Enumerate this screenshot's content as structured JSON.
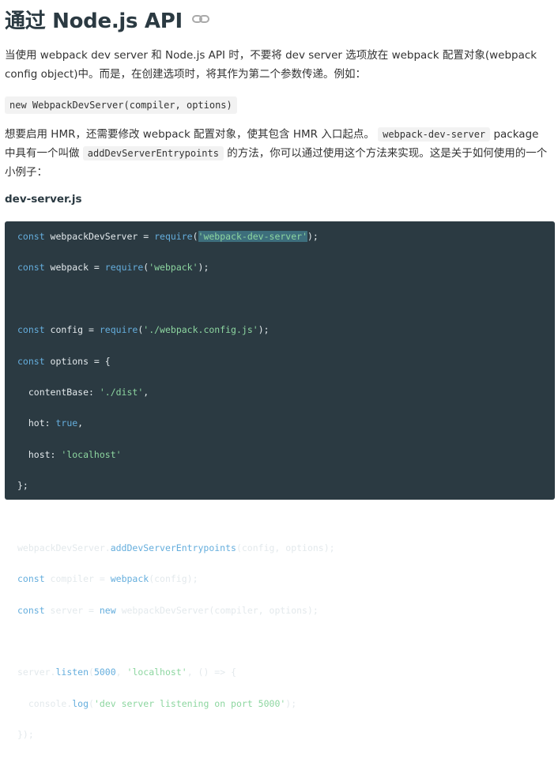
{
  "heading": {
    "title": "通过 Node.js API"
  },
  "intro": {
    "text": "当使用 webpack dev server 和 Node.js API 时，不要将 dev server 选项放在 webpack 配置对象(webpack config object)中。而是，在创建选项时，将其作为第二个参数传递。例如："
  },
  "example_code": "new WebpackDevServer(compiler, options)",
  "hmr": {
    "part1": "想要启用 HMR，还需要修改 webpack 配置对象，使其包含 HMR 入口起点。",
    "code1": "webpack-dev-server",
    "part2": "package 中具有一个叫做",
    "code2": "addDevServerEntrypoints",
    "part3": "的方法，你可以通过使用这个方法来实现。这是关于如何使用的一个小例子："
  },
  "file": {
    "name": "dev-server.js"
  },
  "code": {
    "l1": {
      "a": "const",
      "b": " webpackDevServer = ",
      "c": "require",
      "d": "(",
      "e": "'webpack-dev-server'",
      "f": ");"
    },
    "l2": {
      "a": "const",
      "b": " webpack = ",
      "c": "require",
      "d": "(",
      "e": "'webpack'",
      "f": ");"
    },
    "l4": {
      "a": "const",
      "b": " config = ",
      "c": "require",
      "d": "(",
      "e": "'./webpack.config.js'",
      "f": ");"
    },
    "l5": {
      "a": "const",
      "b": " options = {"
    },
    "l6": {
      "a": "  contentBase: ",
      "b": "'./dist'",
      "c": ","
    },
    "l7": {
      "a": "  hot: ",
      "b": "true",
      "c": ","
    },
    "l8": {
      "a": "  host: ",
      "b": "'localhost'"
    },
    "l9": {
      "a": "};"
    },
    "l11": {
      "a": "webpackDevServer.",
      "b": "addDevServerEntrypoints",
      "c": "(config, options);"
    },
    "l12": {
      "a": "const",
      "b": " compiler = ",
      "c": "webpack",
      "d": "(config);"
    },
    "l13": {
      "a": "const",
      "b": " server = ",
      "c": "new",
      "d": " webpackDevServer(compiler, options);"
    },
    "l15": {
      "a": "server.",
      "b": "listen",
      "c": "(",
      "d": "5000",
      "e": ", ",
      "f": "'localhost'",
      "g": ", () => {"
    },
    "l16": {
      "a": "  console.",
      "b": "log",
      "c": "(",
      "d": "'dev server listening on port 5000'",
      "e": ");"
    },
    "l17": {
      "a": "});"
    }
  },
  "colors": {
    "code_bg": "#2b3a42",
    "keyword": "#65aedd",
    "string": "#8dd6a0",
    "selection": "#3d6e7c"
  },
  "icons": {
    "anchor": "link-icon"
  }
}
